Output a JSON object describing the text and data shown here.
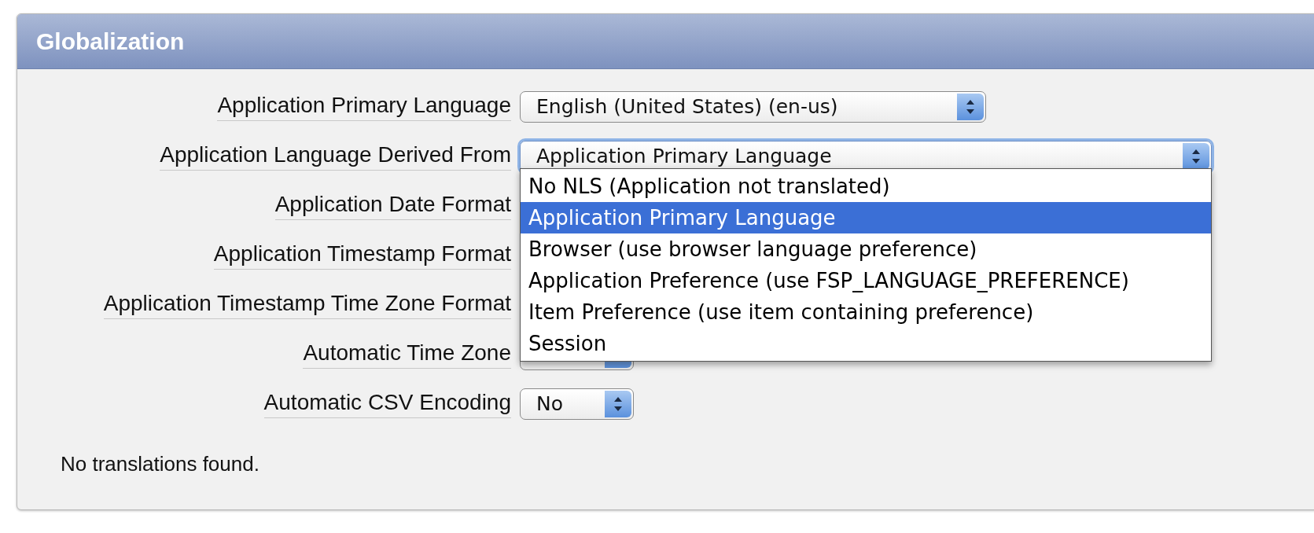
{
  "panel": {
    "title": "Globalization",
    "fields": [
      {
        "label": "Application Primary Language",
        "kind": "select",
        "value": "English (United States) (en-us)",
        "focused": false
      },
      {
        "label": "Application Language Derived From",
        "kind": "select",
        "value": "Application Primary Language",
        "focused": true,
        "options": [
          {
            "label": "No NLS (Application not translated)",
            "selected": false
          },
          {
            "label": "Application Primary Language",
            "selected": true
          },
          {
            "label": "Browser (use browser language preference)",
            "selected": false
          },
          {
            "label": "Application Preference (use FSP_LANGUAGE_PREFERENCE)",
            "selected": false
          },
          {
            "label": "Item Preference (use item containing preference)",
            "selected": false
          },
          {
            "label": "Session",
            "selected": false
          }
        ]
      },
      {
        "label": "Application Date Format",
        "kind": "covered"
      },
      {
        "label": "Application Timestamp Format",
        "kind": "covered"
      },
      {
        "label": "Application Timestamp Time Zone Format",
        "kind": "covered"
      },
      {
        "label": "Automatic Time Zone",
        "kind": "select",
        "focused": false
      },
      {
        "label": "Automatic CSV Encoding",
        "kind": "select",
        "value": "No",
        "focused": false
      }
    ],
    "message": "No translations found."
  }
}
